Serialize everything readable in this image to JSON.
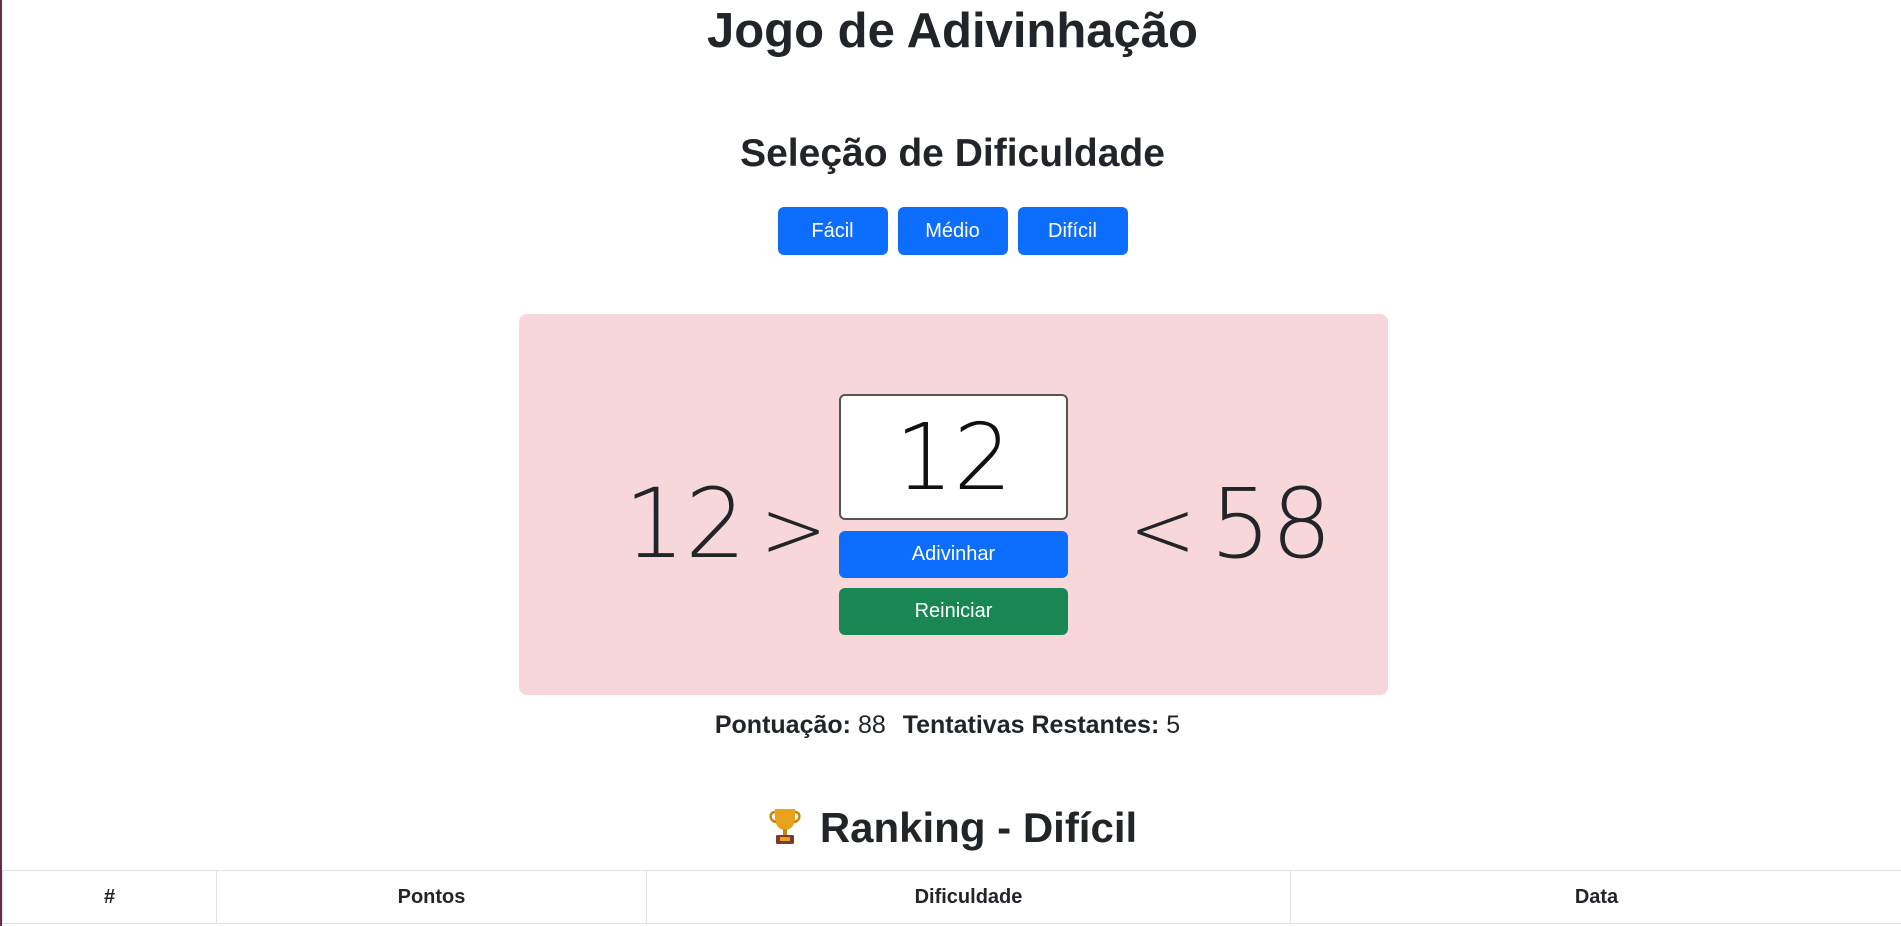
{
  "title": "Jogo de Adivinhação",
  "difficulty": {
    "heading": "Seleção de Dificuldade",
    "buttons": [
      "Fácil",
      "Médio",
      "Difícil"
    ]
  },
  "game": {
    "low_bound": "12",
    "low_symbol": ">",
    "high_symbol": "<",
    "high_bound": "58",
    "guess_value": "12",
    "guess_button": "Adivinhar",
    "restart_button": "Reiniciar",
    "panel_color": "#f8d7da"
  },
  "stats": {
    "score_label": "Pontuação:",
    "score_value": "88",
    "attempts_label": "Tentativas Restantes:",
    "attempts_value": "5"
  },
  "ranking": {
    "icon": "trophy-icon",
    "title": "Ranking - Difícil",
    "columns": [
      "#",
      "Pontos",
      "Dificuldade",
      "Data"
    ]
  },
  "colors": {
    "primary": "#0d6efd",
    "success": "#198754"
  }
}
